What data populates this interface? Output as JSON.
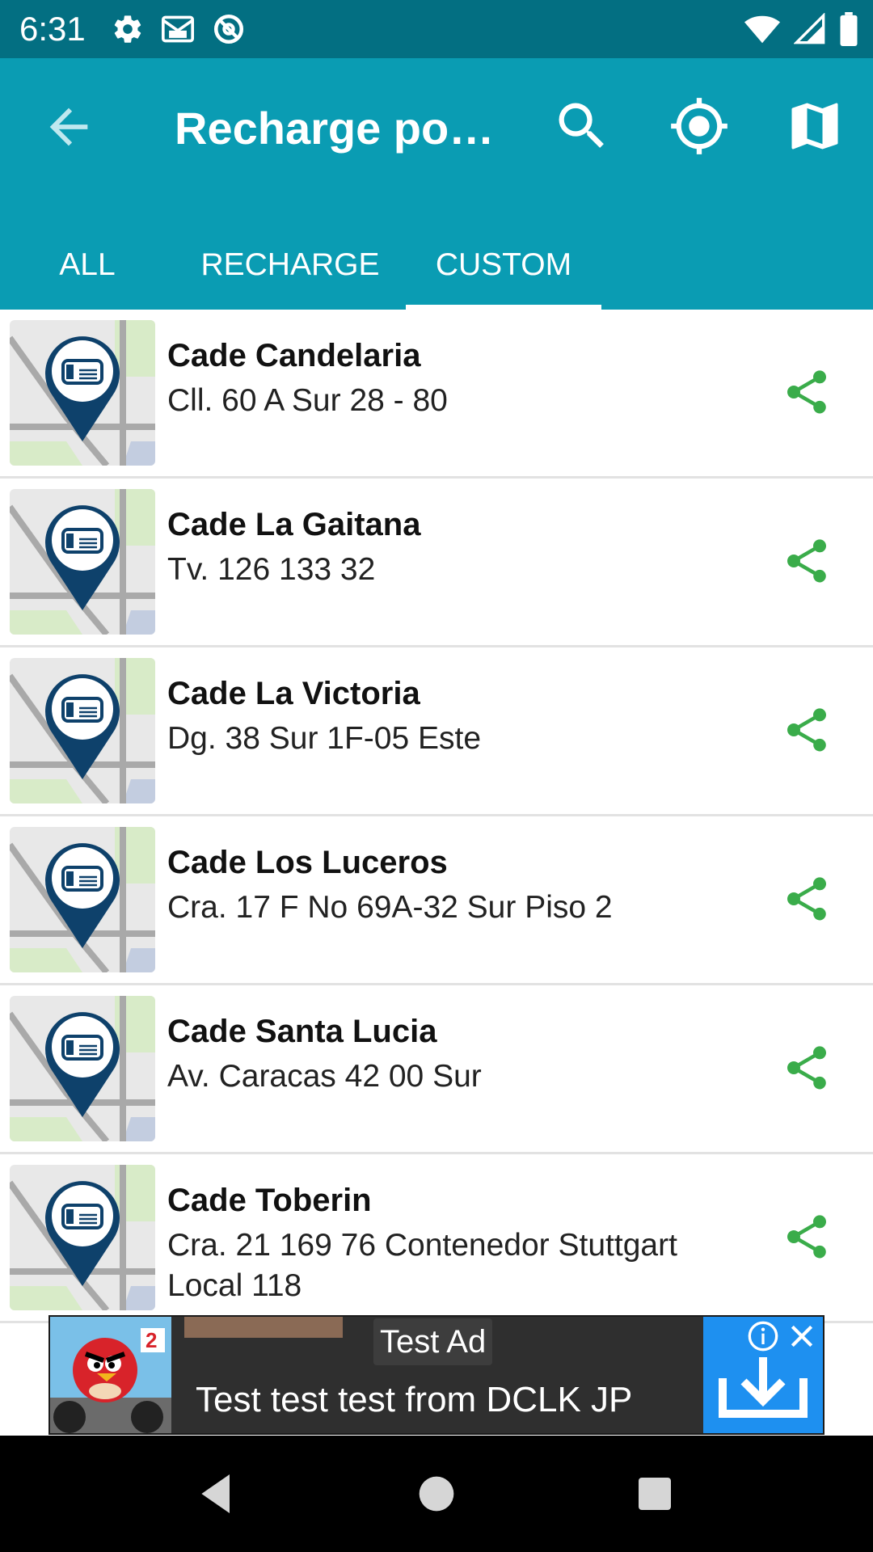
{
  "status_bar": {
    "time": "6:31",
    "left_icons": [
      "settings-icon",
      "gmail-icon",
      "at-sign-icon"
    ],
    "right_icons": [
      "wifi-icon",
      "signal-icon",
      "battery-icon"
    ]
  },
  "app_bar": {
    "title": "Recharge poi…",
    "actions": [
      "search-icon",
      "my-location-icon",
      "map-icon"
    ]
  },
  "tabs": [
    {
      "label": "ALL",
      "selected": false
    },
    {
      "label": "RECHARGE",
      "selected": false
    },
    {
      "label": "CUSTOM",
      "selected": true
    }
  ],
  "items": [
    {
      "name": "Cade Candelaria",
      "address": "Cll. 60 A Sur 28 - 80"
    },
    {
      "name": "Cade La Gaitana",
      "address": "Tv. 126 133 32"
    },
    {
      "name": "Cade La Victoria",
      "address": "Dg. 38 Sur 1F-05 Este"
    },
    {
      "name": "Cade Los Luceros",
      "address": "Cra. 17 F No 69A-32 Sur Piso 2"
    },
    {
      "name": "Cade Santa Lucia",
      "address": "Av. Caracas 42 00 Sur"
    },
    {
      "name": "Cade Toberin",
      "address": "Cra. 21 169 76 Contenedor Stuttgart Local 118"
    }
  ],
  "ad": {
    "label": "Test Ad",
    "text": "Test test test from DCLK JP"
  },
  "colors": {
    "status_bar": "#036f82",
    "app_bar": "#0a9cb3",
    "share_green": "#3aac4a",
    "pin_blue": "#0e416b"
  }
}
